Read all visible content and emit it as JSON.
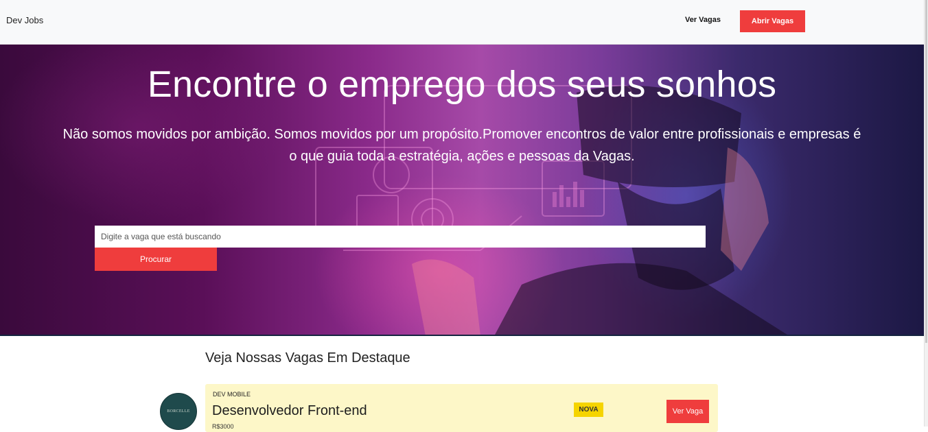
{
  "navbar": {
    "brand": "Dev Jobs",
    "link_label": "Ver Vagas",
    "cta_label": "Abrir Vagas"
  },
  "hero": {
    "title": "Encontre o emprego dos seus sonhos",
    "subtitle": "Não somos movidos por ambição. Somos movidos por um propósito.Promover encontros de valor entre profissionais e empresas é o que guia toda a estratégia, ações e pessoas da Vagas.",
    "search": {
      "placeholder": "Digite a vaga que está buscando",
      "value": "",
      "button_label": "Procurar"
    }
  },
  "featured": {
    "title": "Veja Nossas Vagas Em Destaque",
    "jobs": [
      {
        "company": "DEV MOBILE",
        "title": "Desenvolvedor Front-end",
        "badge": "NOVA",
        "button_label": "Ver Vaga",
        "meta": "R$3000",
        "logo_text": "BORCELLE",
        "card_color": "#fdf7c8"
      }
    ]
  },
  "colors": {
    "accent": "#ef3d3d",
    "badge": "#f5d400",
    "navbar_bg": "#f8f9fa"
  }
}
